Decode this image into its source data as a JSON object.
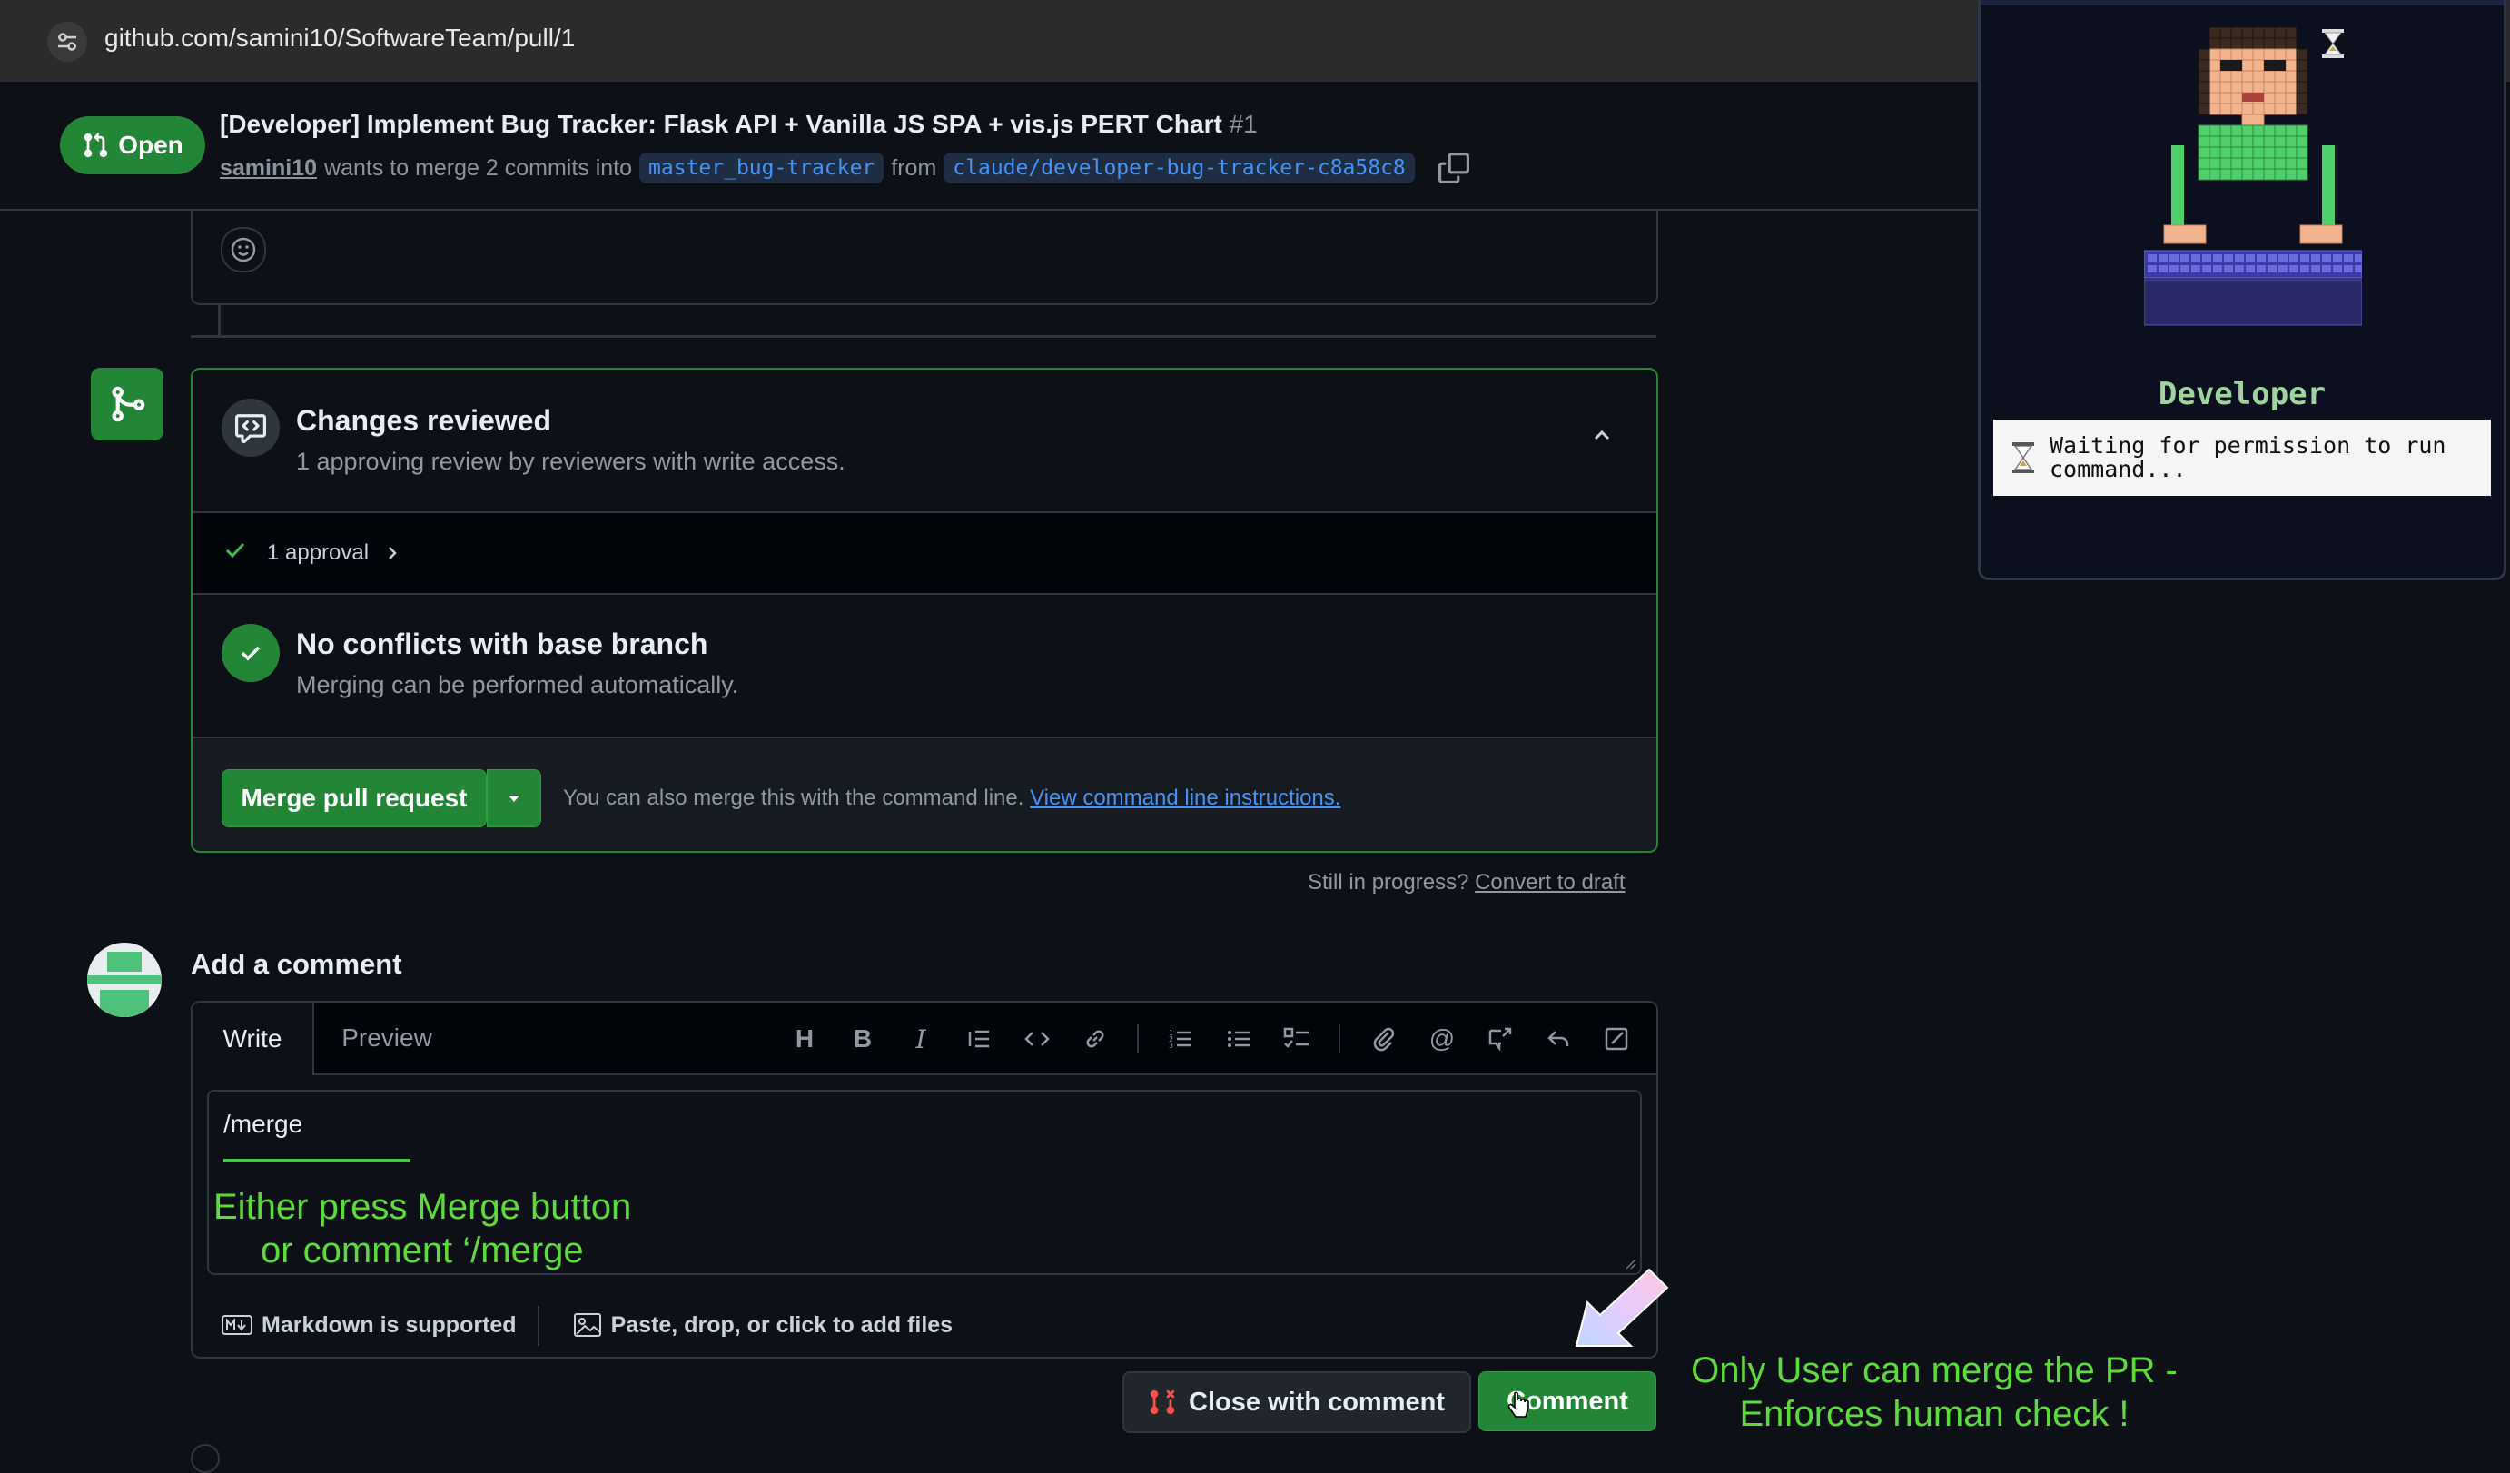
{
  "browser": {
    "url": "github.com/samini10/SoftwareTeam/pull/1"
  },
  "pr": {
    "state": "Open",
    "title": "[Developer] Implement Bug Tracker: Flask API + Vanilla JS SPA + vis.js PERT Chart",
    "number": "#1",
    "author": "samini10",
    "wants_text": "wants to merge 2 commits into",
    "base_branch": "master_bug-tracker",
    "from_text": "from",
    "head_branch": "claude/developer-bug-tracker-c8a58c8"
  },
  "review": {
    "title": "Changes reviewed",
    "subtitle": "1 approving review by reviewers with write access.",
    "approvals": "1 approval"
  },
  "conflicts": {
    "title": "No conflicts with base branch",
    "subtitle": "Merging can be performed automatically."
  },
  "merge": {
    "button": "Merge pull request",
    "hint": "You can also merge this with the command line.",
    "hint_link": "View command line instructions."
  },
  "draft": {
    "question": "Still in progress?",
    "link": "Convert to draft"
  },
  "comment": {
    "heading": "Add a comment",
    "tab_write": "Write",
    "tab_preview": "Preview",
    "value": "/merge",
    "markdown_note": "Markdown is supported",
    "attach_note": "Paste, drop, or click to add files",
    "close_button": "Close with comment",
    "comment_button": "Comment"
  },
  "annotations": {
    "merge_hint_line1": "Either press Merge button",
    "merge_hint_line2": "or comment ‘/merge",
    "human_check_line1": "Only User can merge the PR -",
    "human_check_line2": "Enforces human check !"
  },
  "agent": {
    "name": "Developer",
    "status": "Waiting for permission to run command..."
  },
  "colors": {
    "accent_green": "#238636",
    "annotation_green": "#5bdc3b",
    "link_blue": "#4493f8",
    "background": "#0d1117"
  }
}
